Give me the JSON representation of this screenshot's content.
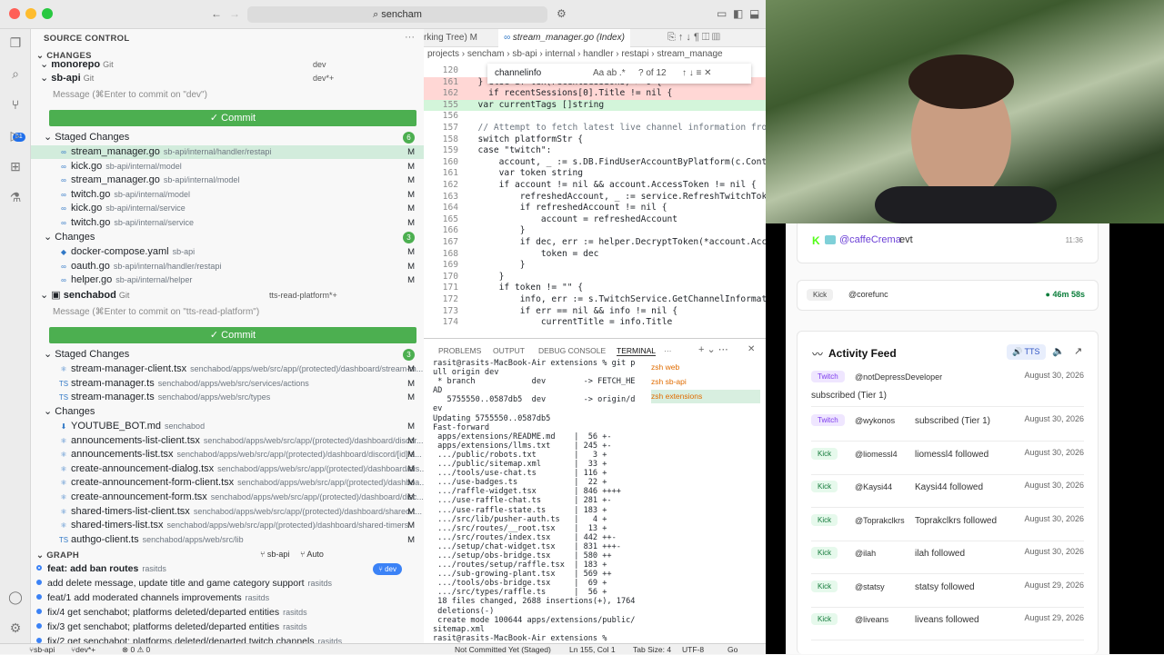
{
  "titlebar": {
    "search_text": "sencham"
  },
  "activity_badge": "51",
  "sidebar": {
    "title": "SOURCE CONTROL",
    "changes_header": "CHANGES",
    "repos": [
      {
        "name": "monorepo",
        "kind": "Git",
        "branch": "dev"
      },
      {
        "name": "sb-api",
        "kind": "Git",
        "branch": "dev*+"
      }
    ],
    "commit_placeholder_1": "Message (⌘Enter to commit on \"dev\")",
    "commit_label": "✓ Commit",
    "staged_label": "Staged Changes",
    "staged_count": "6",
    "staged": [
      {
        "icon": "∞",
        "name": "stream_manager.go",
        "path": "sb-api/internal/handler/restapi",
        "status": "M"
      },
      {
        "icon": "∞",
        "name": "kick.go",
        "path": "sb-api/internal/model",
        "status": "M"
      },
      {
        "icon": "∞",
        "name": "stream_manager.go",
        "path": "sb-api/internal/model",
        "status": "M"
      },
      {
        "icon": "∞",
        "name": "twitch.go",
        "path": "sb-api/internal/model",
        "status": "M"
      },
      {
        "icon": "∞",
        "name": "kick.go",
        "path": "sb-api/internal/service",
        "status": "M"
      },
      {
        "icon": "∞",
        "name": "twitch.go",
        "path": "sb-api/internal/service",
        "status": "M"
      }
    ],
    "changes_label": "Changes",
    "changes_count": "3",
    "changes": [
      {
        "icon": "◆",
        "name": "docker-compose.yaml",
        "path": "sb-api",
        "status": "M"
      },
      {
        "icon": "∞",
        "name": "oauth.go",
        "path": "sb-api/internal/handler/restapi",
        "status": "M"
      },
      {
        "icon": "∞",
        "name": "helper.go",
        "path": "sb-api/internal/helper",
        "status": "M"
      }
    ],
    "repo2": {
      "name": "senchabod",
      "kind": "Git",
      "branch": "tts-read-platform*+"
    },
    "commit_placeholder_2": "Message (⌘Enter to commit on \"tts-read-platform\")",
    "staged2_label": "Staged Changes",
    "staged2_count": "3",
    "staged2": [
      {
        "icon": "⚛",
        "name": "stream-manager-client.tsx",
        "path": "senchabod/apps/web/src/app/(protected)/dashboard/stream-m...",
        "status": "M"
      },
      {
        "icon": "TS",
        "name": "stream-manager.ts",
        "path": "senchabod/apps/web/src/services/actions",
        "status": "M"
      },
      {
        "icon": "TS",
        "name": "stream-manager.ts",
        "path": "senchabod/apps/web/src/types",
        "status": "M"
      }
    ],
    "changes2_label": "Changes",
    "changes2": [
      {
        "icon": "⬇",
        "name": "YOUTUBE_BOT.md",
        "path": "senchabod",
        "status": "M"
      },
      {
        "icon": "⚛",
        "name": "announcements-list-client.tsx",
        "path": "senchabod/apps/web/src/app/(protected)/dashboard/discor...",
        "status": "M"
      },
      {
        "icon": "⚛",
        "name": "announcements-list.tsx",
        "path": "senchabod/apps/web/src/app/(protected)/dashboard/discord/[id]/a...",
        "status": "M"
      },
      {
        "icon": "⚛",
        "name": "create-announcement-dialog.tsx",
        "path": "senchabod/apps/web/src/app/(protected)/dashboard/dis...",
        "status": "M"
      },
      {
        "icon": "⚛",
        "name": "create-announcement-form-client.tsx",
        "path": "senchabod/apps/web/src/app/(protected)/dashboa...",
        "status": "M"
      },
      {
        "icon": "⚛",
        "name": "create-announcement-form.tsx",
        "path": "senchabod/apps/web/src/app/(protected)/dashboard/disc...",
        "status": "M"
      },
      {
        "icon": "⚛",
        "name": "shared-timers-list-client.tsx",
        "path": "senchabod/apps/web/src/app/(protected)/dashboard/shared-t...",
        "status": "M"
      },
      {
        "icon": "⚛",
        "name": "shared-timers-list.tsx",
        "path": "senchabod/apps/web/src/app/(protected)/dashboard/shared-timers",
        "status": "M"
      },
      {
        "icon": "TS",
        "name": "authgo-client.ts",
        "path": "senchabod/apps/web/src/lib",
        "status": "M"
      }
    ],
    "graph_header": "GRAPH",
    "graph_repo": "sb-api",
    "graph_auto": "Auto",
    "graph": [
      {
        "msg": "feat: add ban routes",
        "author": "rasitds",
        "tag": "dev"
      },
      {
        "msg": "add delete message, update title and game category support",
        "author": "rasitds"
      },
      {
        "msg": "feat/1 add moderated channels improvements",
        "author": "rasitds"
      },
      {
        "msg": "fix/4 get senchabot; platforms deleted/departed entities",
        "author": "rasitds"
      },
      {
        "msg": "fix/3 get senchabot; platforms deleted/departed entities",
        "author": "rasitds"
      },
      {
        "msg": "fix/2 get senchabot: platforms deleted/departed twitch channels",
        "author": "rasitds"
      }
    ]
  },
  "editor": {
    "tab1": "rking Tree)  M",
    "tab2": "stream_manager.go (Index)",
    "crumbs": "projects  ›  sencham  ›  sb-api  ›  internal  ›  handler  ›  restapi  ›  stream_manage",
    "find_query": "channelinfo",
    "find_result": "? of 12",
    "lines": [
      {
        "n": "120",
        "t": ""
      },
      {
        "n": "161",
        "t": "  } else if len(recentSessions) > 0 {"
      },
      {
        "n": "162",
        "t": "    if recentSessions[0].Title != nil {"
      },
      {
        "n": "155",
        "t": "  var currentTags []string"
      },
      {
        "n": "156",
        "t": ""
      },
      {
        "n": "157",
        "t": "  // Attempt to fetch latest live channel information from"
      },
      {
        "n": "158",
        "t": "  switch platformStr {"
      },
      {
        "n": "159",
        "t": "  case \"twitch\":"
      },
      {
        "n": "160",
        "t": "      account, _ := s.DB.FindUserAccountByPlatform(c.Context"
      },
      {
        "n": "161",
        "t": "      var token string"
      },
      {
        "n": "162",
        "t": "      if account != nil && account.AccessToken != nil {"
      },
      {
        "n": "163",
        "t": "          refreshedAccount, _ := service.RefreshTwitchToken"
      },
      {
        "n": "164",
        "t": "          if refreshedAccount != nil {"
      },
      {
        "n": "165",
        "t": "              account = refreshedAccount"
      },
      {
        "n": "166",
        "t": "          }"
      },
      {
        "n": "167",
        "t": "          if dec, err := helper.DecryptToken(*account.Access"
      },
      {
        "n": "168",
        "t": "              token = dec"
      },
      {
        "n": "169",
        "t": "          }"
      },
      {
        "n": "170",
        "t": "      }"
      },
      {
        "n": "171",
        "t": "      if token != \"\" {"
      },
      {
        "n": "172",
        "t": "          info, err := s.TwitchService.GetChannelInformation"
      },
      {
        "n": "173",
        "t": "          if err == nil && info != nil {"
      },
      {
        "n": "174",
        "t": "              currentTitle = info.Title"
      }
    ]
  },
  "panel": {
    "tabs": [
      "PROBLEMS",
      "OUTPUT",
      "DEBUG CONSOLE",
      "TERMINAL",
      "···"
    ],
    "terminal": "rasit@rasits-MacBook-Air extensions % git p\null origin dev\n * branch            dev        -> FETCH_HE\nAD\n   5755550..0587db5  dev        -> origin/d\nev\nUpdating 5755550..0587db5\nFast-forward\n apps/extensions/README.md    |  56 +-\n apps/extensions/llms.txt     | 245 +-\n .../public/robots.txt        |   3 +\n .../public/sitemap.xml       |  33 +\n .../tools/use-chat.ts        | 116 +\n .../use-badges.ts            |  22 +\n .../raffle-widget.tsx        | 846 ++++\n .../use-raffle-chat.ts       | 281 +-\n .../use-raffle-state.ts      | 183 +\n .../src/lib/pusher-auth.ts   |   4 +\n .../src/routes/__root.tsx    |  13 +\n .../src/routes/index.tsx     | 442 ++-\n .../setup/chat-widget.tsx    | 831 +++-\n .../setup/obs-bridge.tsx     | 580 ++\n .../routes/setup/raffle.tsx  | 183 +\n .../sub-growing-plant.tsx    | 569 ++\n .../tools/obs-bridge.tsx     |  69 +\n .../src/types/raffle.ts      |  56 +\n 18 files changed, 2688 insertions(+), 1764\n deletions(-)\n create mode 100644 apps/extensions/public/\nsitemap.xml\nrasit@rasits-MacBook-Air extensions % ",
    "terms": [
      "zsh  web",
      "zsh  sb-api",
      "zsh  extensions"
    ]
  },
  "status": {
    "branch_repo": "sb-api",
    "branch": "dev*+",
    "errors": "⊗ 0 ⚠ 0",
    "commit_state": "Not Committed Yet (Staged)",
    "cursor": "Ln 155, Col 1",
    "tab": "Tab Size: 4",
    "enc": "UTF-8",
    "lang": "Go"
  },
  "chat": {
    "top_user": "@caffeCrema",
    "top_text": "evt",
    "top_time": "11:36",
    "kick_label": "Kick",
    "live_user": "@corefunc",
    "live_time": "46m 58s",
    "feed_title": "Activity Feed",
    "tts_label": "TTS",
    "feed": [
      {
        "platform": "Twitch",
        "user": "@notDepressDeveloper",
        "text": "subscribed (Tier 1)",
        "date": "August 30, 2026"
      },
      {
        "platform": "Twitch",
        "user": "@wykonos",
        "text": "subscribed (Tier 1)",
        "date": "August 30, 2026"
      },
      {
        "platform": "Kick",
        "user": "@liomessl4",
        "text": "liomessl4 followed",
        "date": "August 30, 2026"
      },
      {
        "platform": "Kick",
        "user": "@Kaysi44",
        "text": "Kaysi44 followed",
        "date": "August 30, 2026"
      },
      {
        "platform": "Kick",
        "user": "@Toprakclkrs",
        "text": "Toprakclkrs followed",
        "date": "August 30, 2026"
      },
      {
        "platform": "Kick",
        "user": "@ilah",
        "text": "ilah followed",
        "date": "August 30, 2026"
      },
      {
        "platform": "Kick",
        "user": "@statsy",
        "text": "statsy followed",
        "date": "August 29, 2026"
      },
      {
        "platform": "Kick",
        "user": "@liveans",
        "text": "liveans followed",
        "date": "August 29, 2026"
      }
    ]
  },
  "colors": {
    "commit_green": "#4caf50",
    "kick_green": "#53fc18",
    "twitch_purple": "#9146ff",
    "accent": "#1f6feb"
  }
}
